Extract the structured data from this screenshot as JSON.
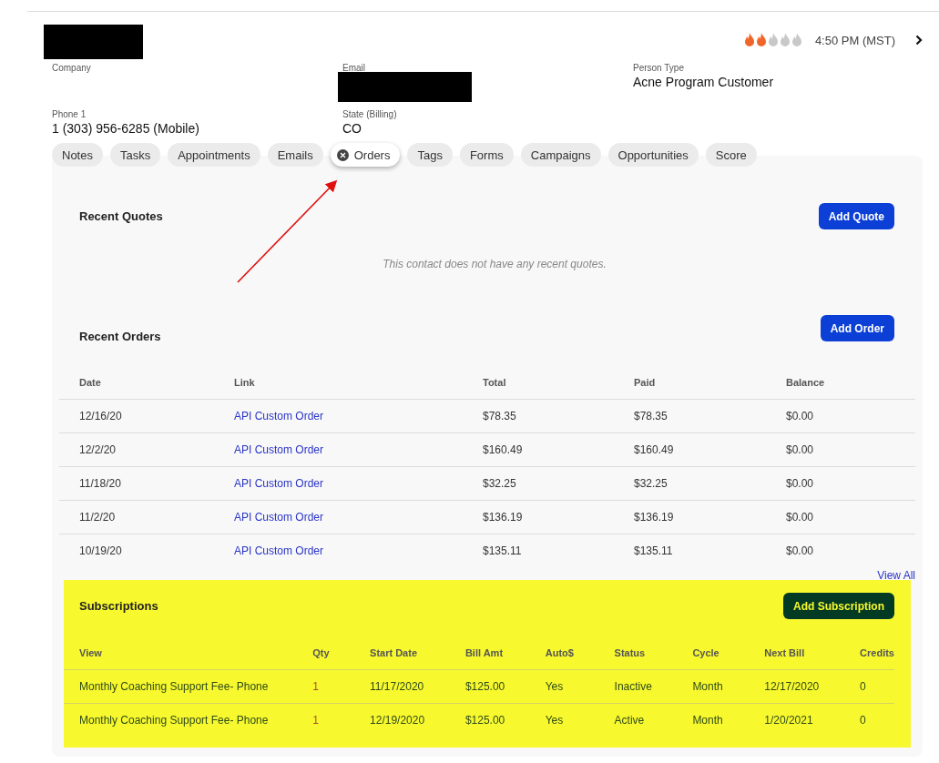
{
  "header": {
    "rating": {
      "stars": 2
    },
    "time": "4:50 PM (MST)"
  },
  "fields": [
    {
      "label": "Company",
      "kind": "text"
    },
    {
      "label": "Email",
      "kind": "redacted"
    },
    {
      "label": "Person Type",
      "value": "Acne Program Customer",
      "kind": "text"
    },
    {
      "label": "Phone 1",
      "value": "1 (303) 956-6285 (Mobile)",
      "kind": "text"
    },
    {
      "label": "State (Billing)",
      "value": "CO",
      "kind": "text"
    }
  ],
  "tabs": [
    {
      "label": "Notes",
      "selected": false
    },
    {
      "label": "Tasks",
      "selected": false
    },
    {
      "label": "Appointments",
      "selected": false
    },
    {
      "label": "Emails",
      "selected": false
    },
    {
      "label": "Orders",
      "selected": true
    },
    {
      "label": "Tags",
      "selected": false
    },
    {
      "label": "Forms",
      "selected": false
    },
    {
      "label": "Campaigns",
      "selected": false
    },
    {
      "label": "Opportunities",
      "selected": false
    },
    {
      "label": "Score",
      "selected": false
    }
  ],
  "recent_quotes": {
    "title": "Recent Quotes",
    "button": "Add Quote",
    "empty_message": "This contact does not have any recent quotes."
  },
  "recent_orders": {
    "title": "Recent Orders",
    "button": "Add Order",
    "columns": [
      "Date",
      "Link",
      "Total",
      "Paid",
      "Balance"
    ],
    "rows": [
      [
        "12/16/20",
        "API Custom Order",
        "$78.35",
        "$78.35",
        "$0.00"
      ],
      [
        "12/2/20",
        "API Custom Order",
        "$160.49",
        "$160.49",
        "$0.00"
      ],
      [
        "11/18/20",
        "API Custom Order",
        "$32.25",
        "$32.25",
        "$0.00"
      ],
      [
        "11/2/20",
        "API Custom Order",
        "$136.19",
        "$136.19",
        "$0.00"
      ],
      [
        "10/19/20",
        "API Custom Order",
        "$135.11",
        "$135.11",
        "$0.00"
      ]
    ],
    "view_all": "View All"
  },
  "subscriptions": {
    "title": "Subscriptions",
    "button": "Add Subscription",
    "highlighted": true,
    "columns": [
      "View",
      "Qty",
      "Start Date",
      "Bill Amt",
      "Auto$",
      "Status",
      "Cycle",
      "Next Bill",
      "Credits"
    ],
    "rows": [
      [
        "Monthly Coaching Support Fee- Phone",
        "1",
        "11/17/2020",
        "$125.00",
        "Yes",
        "Inactive",
        "Month",
        "12/17/2020",
        "0"
      ],
      [
        "Monthly Coaching Support Fee- Phone",
        "1",
        "12/19/2020",
        "$125.00",
        "Yes",
        "Active",
        "Month",
        "1/20/2021",
        "0"
      ]
    ]
  }
}
